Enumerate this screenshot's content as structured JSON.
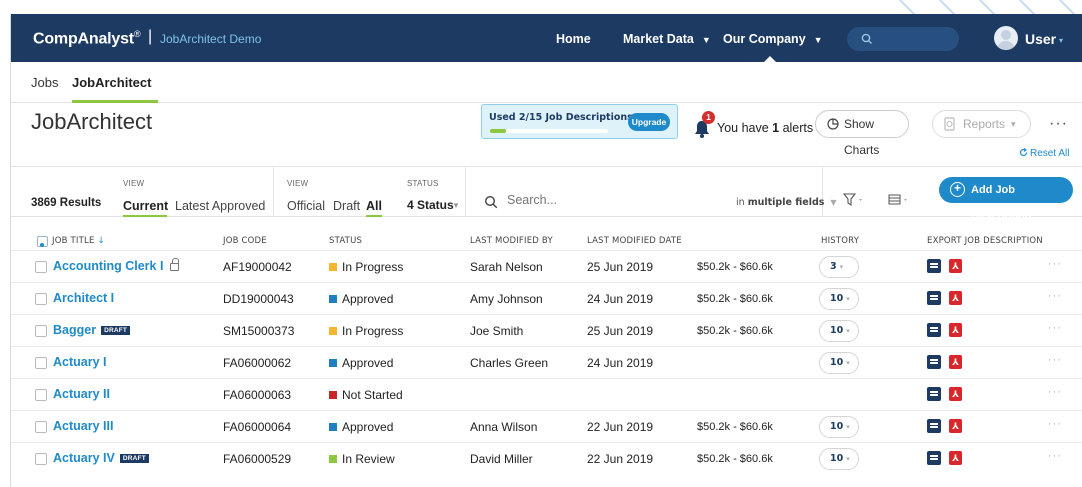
{
  "colors": {
    "header_bg": "#1d3a63",
    "accent_blue": "#1f8ac9",
    "accent_green": "#8dc63f",
    "status_in_progress": "#f5b731",
    "status_approved": "#1f7fc4",
    "status_not_started": "#c62828",
    "status_in_review": "#8dc63f"
  },
  "topbar": {
    "brand": "CompAnalyst",
    "brand_mark": "®",
    "separator": "|",
    "product": "JobArchitect Demo",
    "nav": [
      {
        "label": "Home",
        "caret": ""
      },
      {
        "label": "Market Data",
        "caret": "▼"
      },
      {
        "label": "Our Company",
        "caret": "▼"
      }
    ],
    "search_icon": "search-icon",
    "user_label": "User",
    "user_caret": "▾"
  },
  "subnav": {
    "tabs": [
      {
        "label": "Jobs"
      },
      {
        "label": "JobArchitect"
      }
    ]
  },
  "header": {
    "title": "JobArchitect",
    "usage_text": "Used 2/15 Job Descriptions",
    "usage_fraction": 0.1333,
    "upgrade_label": "Upgrade",
    "alert_count": "1",
    "alerts_prefix": "You have ",
    "alerts_count_text": "1",
    "alerts_suffix": " alerts",
    "show_charts_label": "Show Charts",
    "reports_label": "Reports",
    "reports_caret": "▾",
    "more": "···",
    "reset_all": "Reset All"
  },
  "filters": {
    "results": "3869 Results",
    "view1_label": "VIEW",
    "view1_options": [
      "Current",
      "Latest Approved"
    ],
    "view2_label": "VIEW",
    "view2_options": [
      "Official",
      "Draft",
      "All"
    ],
    "status_label": "STATUS",
    "status_value": "4 Status",
    "search_placeholder": "Search...",
    "fields_prefix": "in ",
    "fields_value": "multiple fields",
    "add_label": "Add Job Description",
    "add_icon": "+"
  },
  "table": {
    "headers": {
      "title": "JOB TITLE",
      "sort": "↓",
      "code": "JOB CODE",
      "status": "STATUS",
      "by": "LAST MODIFIED BY",
      "date": "LAST MODIFIED DATE",
      "history": "HISTORY",
      "export": "EXPORT JOB DESCRIPTION"
    },
    "draft_badge": "DRAFT",
    "hist_caret": "▾",
    "row_more": "···",
    "pdf_glyph": "⅄",
    "rows": [
      {
        "title": "Accounting Clerk I",
        "lock": true,
        "draft": false,
        "code": "AF19000042",
        "status": "In Progress",
        "status_color": "#f5b731",
        "by": "Sarah Nelson",
        "date": "25 Jun 2019",
        "salary": "$50.2k - $60.6k",
        "history": "3"
      },
      {
        "title": "Architect I",
        "lock": false,
        "draft": false,
        "code": "DD19000043",
        "status": "Approved",
        "status_color": "#1f7fc4",
        "by": "Amy Johnson",
        "date": "24 Jun 2019",
        "salary": "$50.2k - $60.6k",
        "history": "10"
      },
      {
        "title": "Bagger",
        "lock": false,
        "draft": true,
        "code": "SM15000373",
        "status": "In Progress",
        "status_color": "#f5b731",
        "by": "Joe Smith",
        "date": "25 Jun 2019",
        "salary": "$50.2k - $60.6k",
        "history": "10"
      },
      {
        "title": "Actuary I",
        "lock": false,
        "draft": false,
        "code": "FA06000062",
        "status": "Approved",
        "status_color": "#1f7fc4",
        "by": "Charles Green",
        "date": "24 Jun 2019",
        "salary": "",
        "history": "10"
      },
      {
        "title": "Actuary II",
        "lock": false,
        "draft": false,
        "code": "FA06000063",
        "status": "Not Started",
        "status_color": "#c62828",
        "by": "",
        "date": "",
        "salary": "",
        "history": ""
      },
      {
        "title": "Actuary III",
        "lock": false,
        "draft": false,
        "code": "FA06000064",
        "status": "Approved",
        "status_color": "#1f7fc4",
        "by": "Anna Wilson",
        "date": "22 Jun 2019",
        "salary": "$50.2k - $60.6k",
        "history": "10"
      },
      {
        "title": "Actuary IV",
        "lock": false,
        "draft": true,
        "code": "FA06000529",
        "status": "In Review",
        "status_color": "#8dc63f",
        "by": "David Miller",
        "date": "22 Jun 2019",
        "salary": "$50.2k - $60.6k",
        "history": "10"
      }
    ]
  }
}
